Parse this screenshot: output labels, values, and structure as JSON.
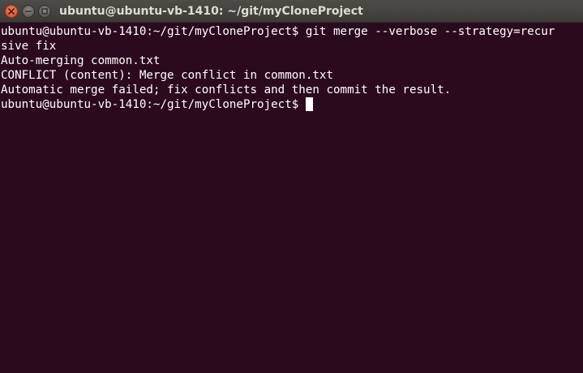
{
  "window": {
    "title": "ubuntu@ubuntu-vb-1410: ~/git/myCloneProject",
    "controls": [
      "close-icon",
      "minimize-icon",
      "maximize-icon"
    ],
    "colors": {
      "close": "#e05a2f",
      "titlebar": "#3c3b37",
      "terminal_bg": "#2c0a1e",
      "text": "#ffffff"
    }
  },
  "terminal": {
    "lines": [
      "ubuntu@ubuntu-vb-1410:~/git/myCloneProject$ git merge --verbose --strategy=recur",
      "sive fix",
      "Auto-merging common.txt",
      "CONFLICT (content): Merge conflict in common.txt",
      "Automatic merge failed; fix conflicts and then commit the result."
    ],
    "prompt": "ubuntu@ubuntu-vb-1410:~/git/myCloneProject$ "
  }
}
